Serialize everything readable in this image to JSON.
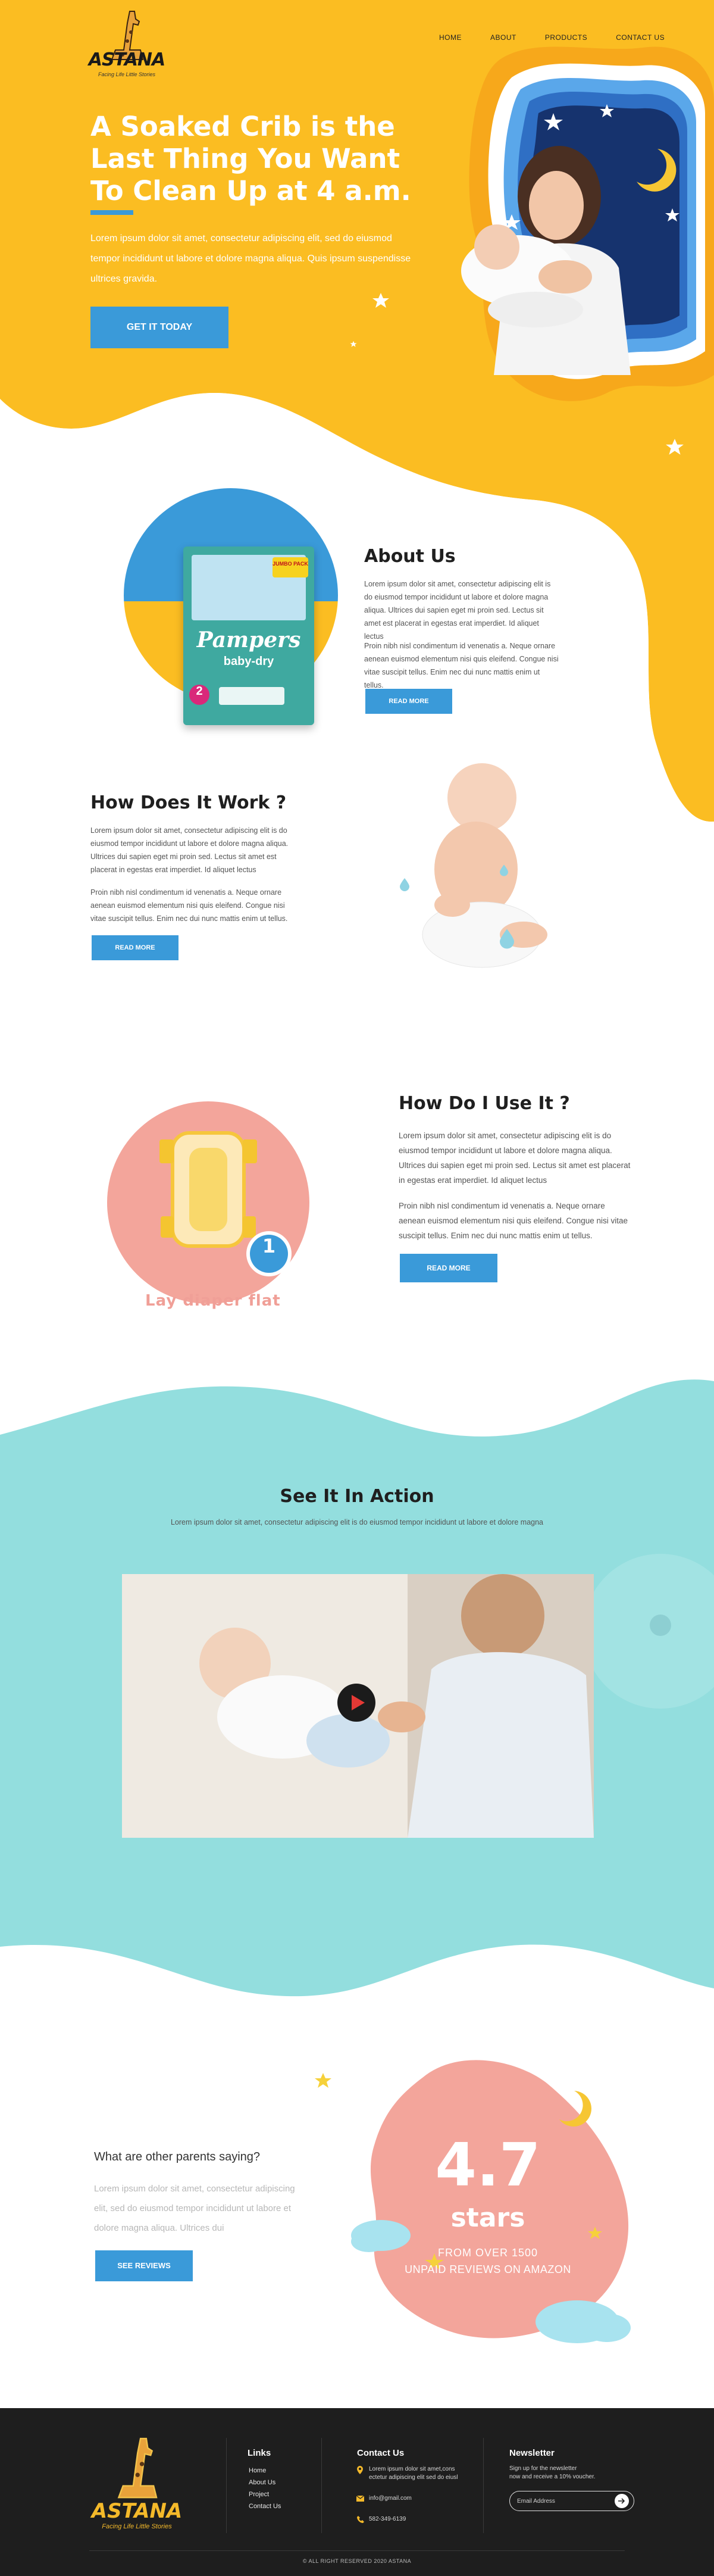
{
  "brand": {
    "logo_text": "ASTANA",
    "tagline": "Facing Life Little Stories"
  },
  "nav": {
    "items": [
      "HOME",
      "ABOUT",
      "PRODUCTS",
      "CONTACT US"
    ]
  },
  "hero": {
    "title": "A Soaked Crib is the Last Thing You Want To Clean Up at 4 a.m.",
    "description": "Lorem ipsum dolor sit amet, consectetur adipiscing elit, sed do eiusmod tempor incididunt ut labore et dolore magna aliqua. Quis ipsum suspendisse ultrices gravida.",
    "button": "GET IT TODAY"
  },
  "about": {
    "title": "About Us",
    "p1": "Lorem ipsum dolor sit amet, consectetur adipiscing elit is do eiusmod tempor incididunt ut labore et dolore magna aliqua. Ultrices dui sapien eget mi proin sed. Lectus sit amet est placerat in egestas erat imperdiet. Id aliquet lectus",
    "p2": "Proin nibh nisl condimentum id venenatis a. Neque ornare aenean euismod elementum nisi quis eleifend. Congue nisi vitae suscipit tellus. Enim nec dui nunc mattis enim ut tellus.",
    "button": "READ MORE",
    "product_brand": "Pampers",
    "product_line": "baby-dry",
    "product_badge": "JUMBO PACK",
    "product_size": "2"
  },
  "how_work": {
    "title": "How Does It Work ?",
    "p1": "Lorem ipsum dolor sit amet, consectetur adipiscing elit is do eiusmod tempor incididunt ut labore et dolore magna aliqua. Ultrices dui sapien eget mi proin sed. Lectus sit amet est placerat in egestas erat imperdiet. Id aliquet lectus",
    "p2": "Proin nibh nisl condimentum id venenatis a. Neque ornare aenean euismod elementum nisi quis eleifend. Congue nisi vitae suscipit tellus. Enim nec dui nunc mattis enim ut tellus.",
    "button": "READ MORE"
  },
  "how_use": {
    "title": "How Do I Use It ?",
    "p1": "Lorem ipsum dolor sit amet, consectetur adipiscing elit is do eiusmod tempor incididunt ut labore et dolore magna aliqua. Ultrices dui sapien eget mi proin sed. Lectus sit amet est placerat in egestas erat imperdiet. Id aliquet lectus",
    "p2": "Proin nibh nisl condimentum id venenatis a. Neque ornare aenean euismod elementum nisi quis eleifend. Congue nisi vitae suscipit tellus. Enim nec dui nunc mattis enim ut tellus.",
    "button": "READ MORE",
    "step_number": "1",
    "step_label": "Lay diaper flat"
  },
  "action": {
    "title": "See It In Action",
    "subtitle": "Lorem ipsum dolor sit amet, consectetur adipiscing elit is do eiusmod tempor incididunt ut labore et dolore magna"
  },
  "reviews": {
    "question": "What are other parents saying?",
    "text": "Lorem ipsum dolor sit amet, consectetur adipiscing elit, sed do eiusmod tempor incididunt ut labore et dolore magna aliqua. Ultrices dui",
    "button": "SEE REVIEWS",
    "rating": "4.7",
    "rating_unit": "stars",
    "from_line": "FROM OVER 1500",
    "source_line": "UNPAID REVIEWS ON AMAZON"
  },
  "footer": {
    "links_title": "Links",
    "links": [
      "Home",
      "About Us",
      "Project",
      "Contact Us"
    ],
    "contact_title": "Contact Us",
    "address_line1": "Lorem ipsum dolor sit amet,cons",
    "address_line2": "ectetur adipiscing elit sed do eiusl",
    "email": "info@gmail.com",
    "phone": "582-349-6139",
    "newsletter_title": "Newsletter",
    "newsletter_line1": "Sign up for the newsletter",
    "newsletter_line2": "now and receive a 10% voucher.",
    "email_placeholder": "Email Address",
    "copyright": "© ALL RIGHT RESERVED 2020 ASTANA"
  },
  "colors": {
    "yellow": "#fbbd22",
    "blue": "#3a9ad9",
    "teal": "#93dede",
    "pink": "#f3a59b",
    "footer": "#1e1e1e"
  },
  "icons": [
    "play-icon",
    "location-icon",
    "mail-icon",
    "phone-icon",
    "arrow-right-icon",
    "star-icon",
    "moon-icon",
    "cloud-icon"
  ]
}
